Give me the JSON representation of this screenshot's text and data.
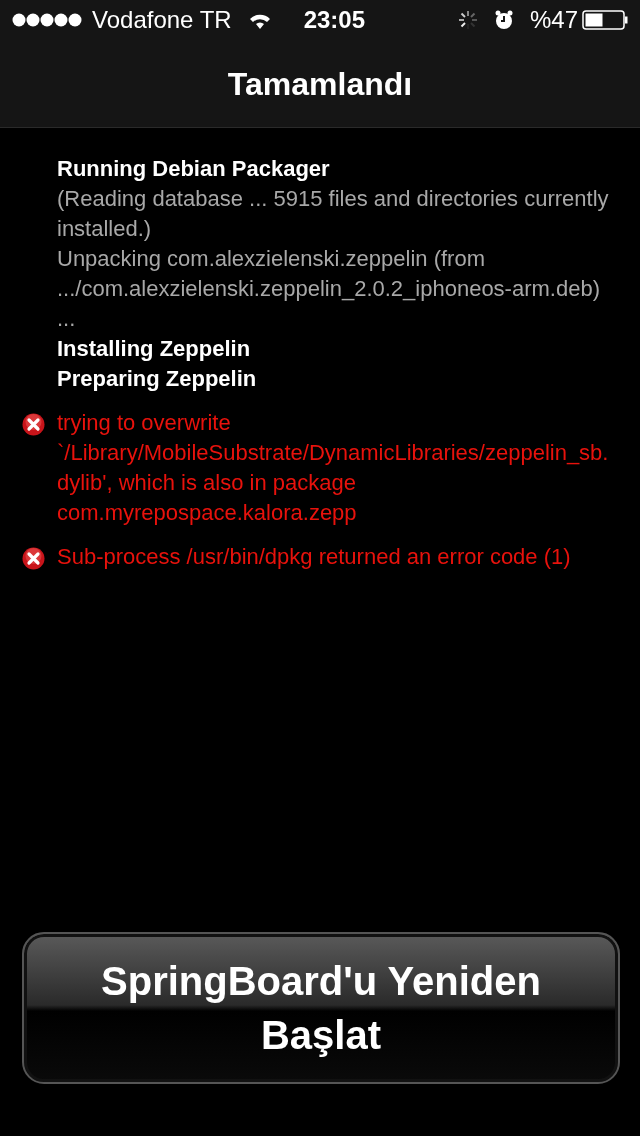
{
  "status_bar": {
    "carrier": "Vodafone TR",
    "time": "23:05",
    "battery": "%47"
  },
  "nav_bar": {
    "title": "Tamamlandı"
  },
  "log": [
    {
      "kind": "heading",
      "text": "Running Debian Packager"
    },
    {
      "kind": "info",
      "text": "(Reading database ... 5915 files and directories currently installed.)"
    },
    {
      "kind": "info",
      "text": "Unpacking com.alexzielenski.zeppelin (from .../com.alexzielenski.zeppelin_2.0.2_iphoneos-arm.deb) ..."
    },
    {
      "kind": "heading",
      "text": "Installing Zeppelin"
    },
    {
      "kind": "heading",
      "text": "Preparing Zeppelin"
    },
    {
      "kind": "error",
      "text": "trying to overwrite `/Library/MobileSubstrate/DynamicLibraries/zeppelin_sb.dylib', which is also in package com.myrepospace.kalora.zepp"
    },
    {
      "kind": "error",
      "text": "Sub-process /usr/bin/dpkg returned an error code (1)"
    }
  ],
  "button": {
    "label": "SpringBoard'u Yeniden Başlat"
  }
}
